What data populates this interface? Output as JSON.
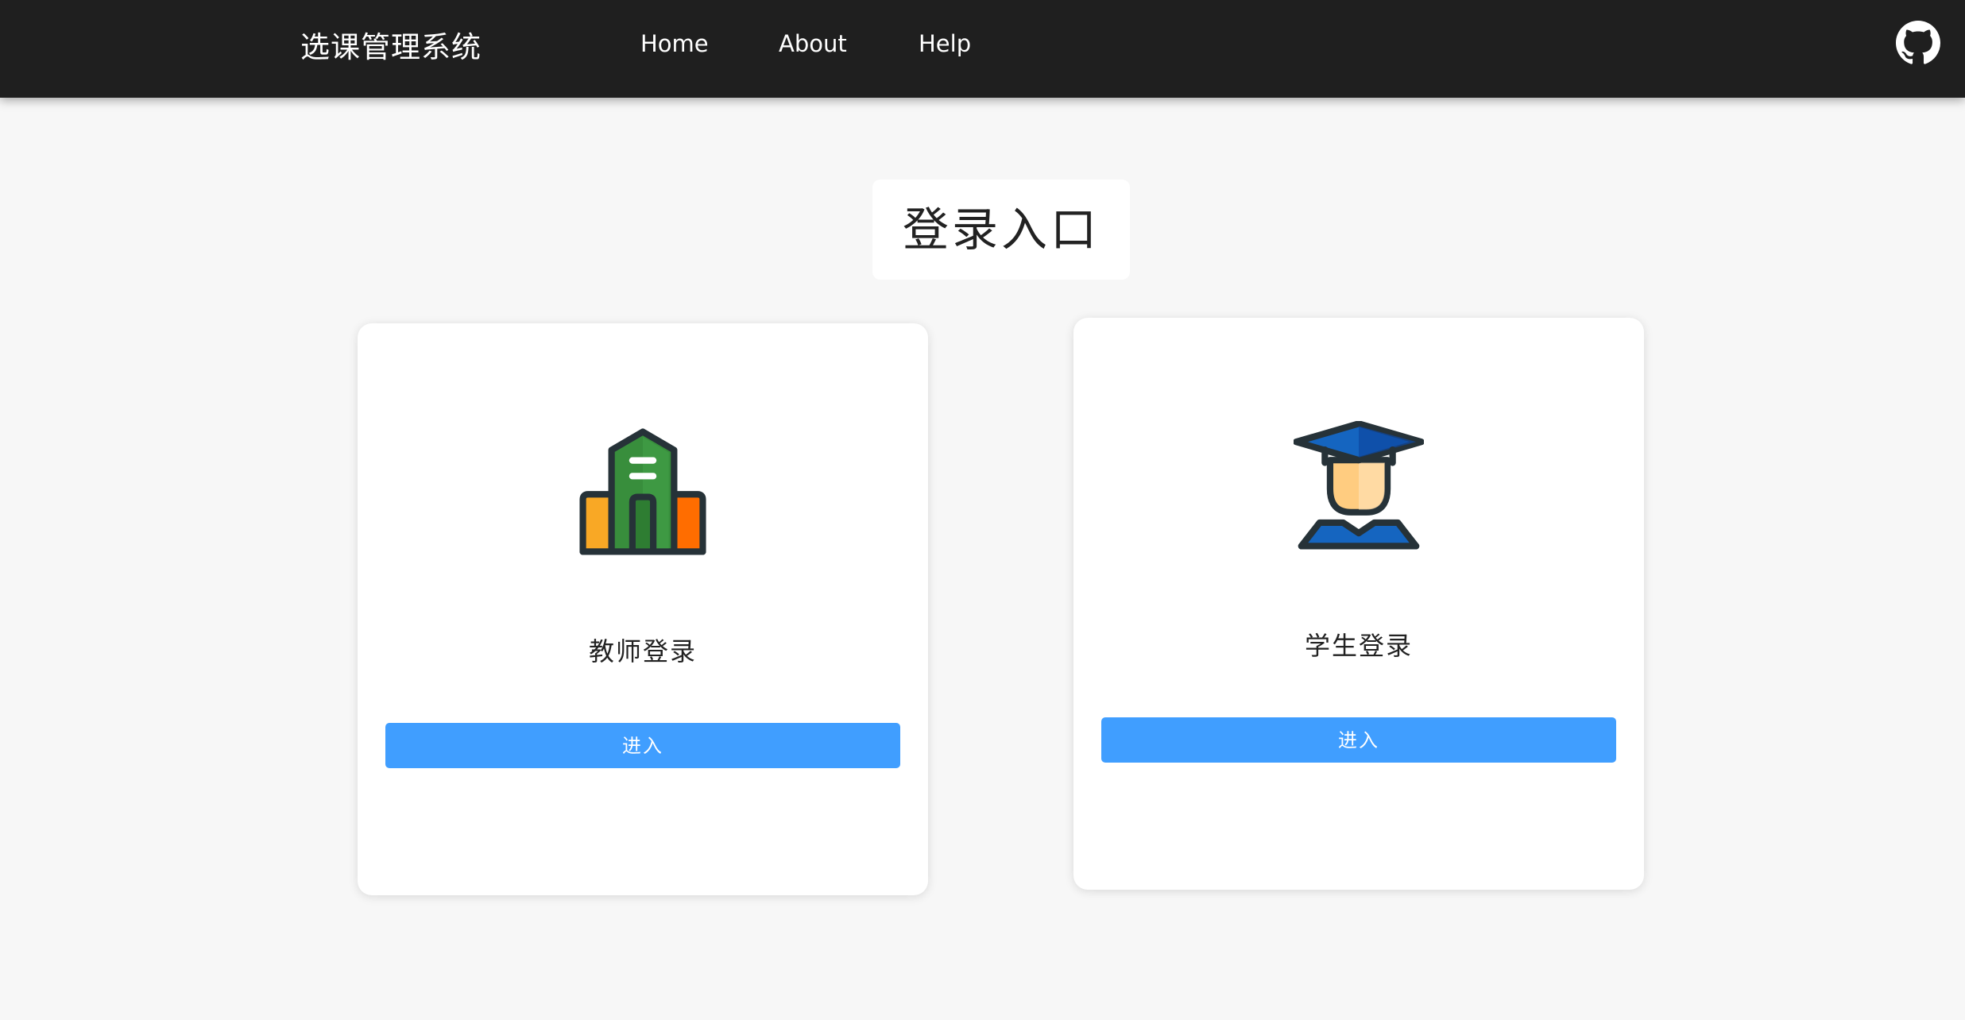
{
  "header": {
    "brand": "选课管理系统",
    "nav": [
      {
        "label": "Home"
      },
      {
        "label": "About"
      },
      {
        "label": "Help"
      }
    ],
    "github_icon": "github-icon"
  },
  "main": {
    "title": "登录入口",
    "cards": [
      {
        "title": "教师登录",
        "button": "进入",
        "icon": "school-building-icon"
      },
      {
        "title": "学生登录",
        "button": "进入",
        "icon": "graduate-student-icon"
      }
    ]
  },
  "colors": {
    "navbar_bg": "#1f1f1f",
    "page_bg": "#f7f7f7",
    "button_primary": "#409eff"
  }
}
